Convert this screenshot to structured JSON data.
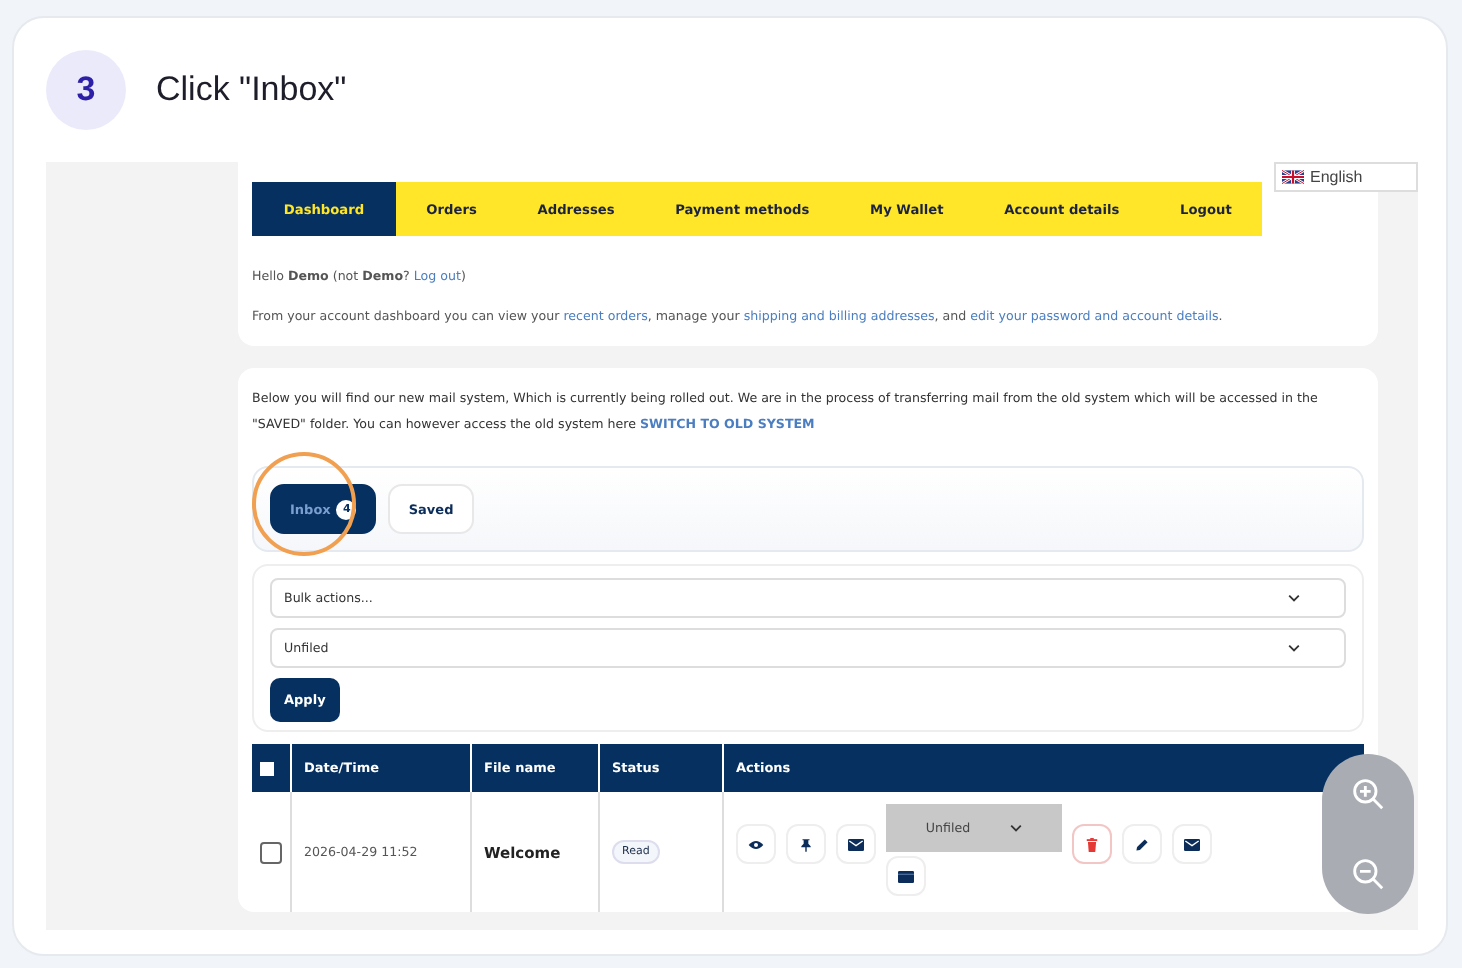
{
  "step": {
    "number": "3",
    "instruction": "Click \"Inbox\""
  },
  "language": {
    "label": "English"
  },
  "nav": [
    {
      "label": "Dashboard",
      "selected": true
    },
    {
      "label": "Orders",
      "selected": false
    },
    {
      "label": "Addresses",
      "selected": false
    },
    {
      "label": "Payment methods",
      "selected": false
    },
    {
      "label": "My Wallet",
      "selected": false
    },
    {
      "label": "Account details",
      "selected": false
    },
    {
      "label": "Logout",
      "selected": false
    }
  ],
  "greeting": [
    {
      "text": "Hello **Demo** (not **Demo**? ",
      "link": false
    },
    {
      "text": "Log out",
      "link": true
    },
    {
      "text": ")",
      "link": false
    }
  ],
  "dashboard_text": [
    {
      "text": "From your account dashboard you can view your ",
      "link": false
    },
    {
      "text": "recent orders",
      "link": true
    },
    {
      "text": ", manage your ",
      "link": false
    },
    {
      "text": "shipping and billing addresses",
      "link": true
    },
    {
      "text": ", and ",
      "link": false
    },
    {
      "text": "edit your password and account details",
      "link": true
    },
    {
      "text": ".",
      "link": false
    }
  ],
  "notice": [
    {
      "text": "Below you will find our new mail system, Which is currently being rolled out. We are in the process of transferring mail from the old system which will be accessed in the \"SAVED\" folder. You can however access the old system here ",
      "link": false
    },
    {
      "text": "SWITCH TO OLD SYSTEM",
      "link": true
    }
  ],
  "mail_tabs": [
    {
      "label": "Inbox",
      "badge": "4",
      "selected": true
    },
    {
      "label": "Saved",
      "selected": false
    }
  ],
  "filters": [
    {
      "value": "Bulk actions..."
    },
    {
      "value": "Unfiled"
    }
  ],
  "apply_button": "Apply",
  "table": {
    "select_all_checked": false,
    "columns": [
      "Date/Time",
      "File name",
      "Status",
      "Actions"
    ],
    "rows": [
      {
        "checked": false,
        "date": "2026-04-29 11:52",
        "file": "Welcome",
        "status": "Read",
        "folder": "Unfiled"
      }
    ]
  }
}
